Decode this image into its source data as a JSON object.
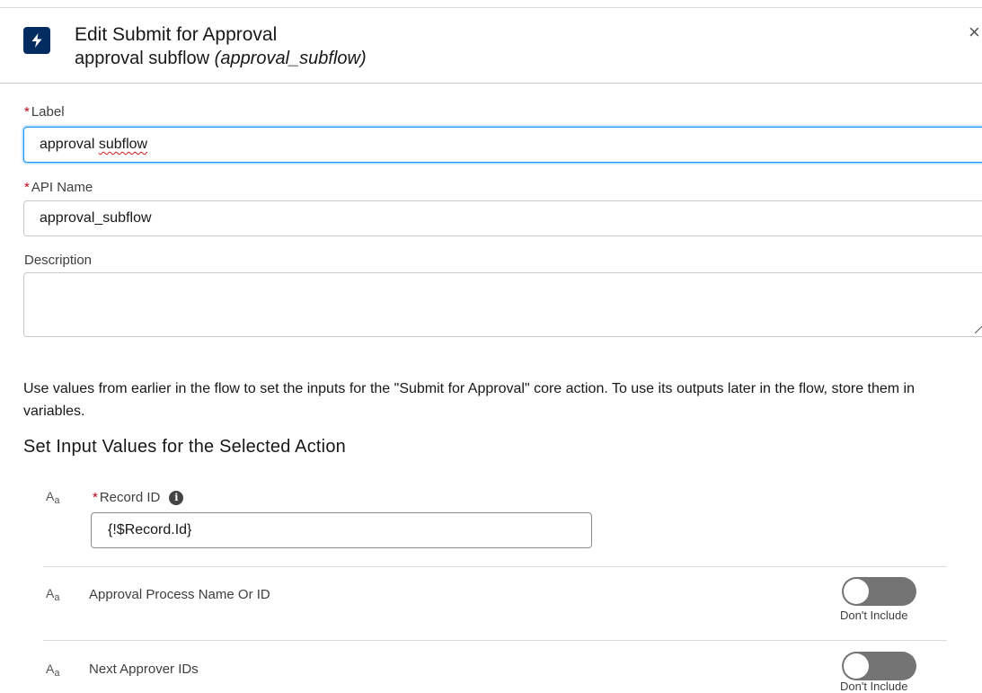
{
  "header": {
    "title": "Edit Submit for Approval",
    "subtitle_name": "approval subflow",
    "subtitle_api": "(approval_subflow)",
    "close_glyph": "×",
    "icon": "flow-lightning-icon"
  },
  "form": {
    "required_marker": "*",
    "label": {
      "label": "Label",
      "value": "approval subflow",
      "value_plain": "approval ",
      "value_misspelled": "subflow"
    },
    "api_name": {
      "label": "API Name",
      "value": "approval_subflow"
    },
    "description": {
      "label": "Description",
      "value": ""
    }
  },
  "help_text": "Use values from earlier in the flow to set the inputs for the \"Submit for Approval\" core action. To use its outputs later in the flow, store them in variables.",
  "section_title": "Set Input Values for the Selected Action",
  "params": {
    "record_id": {
      "label": "Record ID",
      "value": "{!$Record.Id}",
      "info_glyph": "i",
      "required": true
    },
    "approval_process": {
      "label": "Approval Process Name Or ID",
      "toggle_text": "Don't Include",
      "included": false
    },
    "next_approver": {
      "label": "Next Approver IDs",
      "toggle_text": "Don't Include",
      "included": false
    }
  },
  "type_icon": {
    "big": "A",
    "small": "a"
  },
  "colors": {
    "brand_dark": "#032d60",
    "focus": "#1b96ff",
    "required": "#ba0517",
    "toggle_off": "#747474"
  }
}
